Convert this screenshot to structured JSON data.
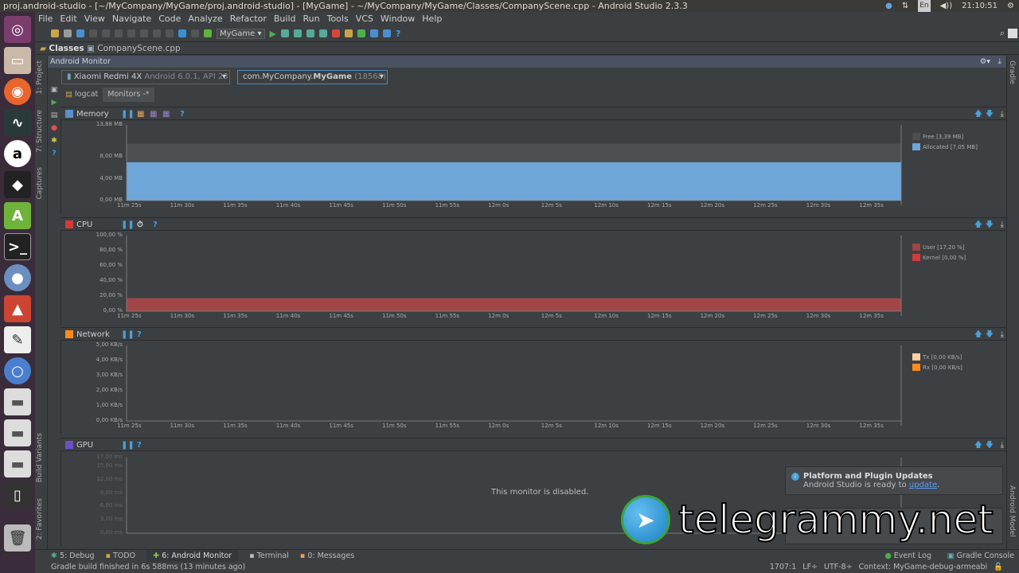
{
  "window_title": "proj.android-studio - [~/MyCompany/MyGame/proj.android-studio] - [MyGame] - ~/MyCompany/MyGame/Classes/CompanyScene.cpp - Android Studio 2.3.3",
  "tray": {
    "lang": "En",
    "time": "21:10:51"
  },
  "menu": [
    "File",
    "Edit",
    "View",
    "Navigate",
    "Code",
    "Analyze",
    "Refactor",
    "Build",
    "Run",
    "Tools",
    "VCS",
    "Window",
    "Help"
  ],
  "toolbar": {
    "run_config": "MyGame ▾",
    "help": "?"
  },
  "breadcrumb": [
    "Classes",
    "CompanyScene.cpp"
  ],
  "left_tool_tabs": [
    "1: Project",
    "7: Structure",
    "Captures",
    "Build Variants",
    "2: Favorites"
  ],
  "right_tool_tabs": [
    "Gradle",
    "Android Model"
  ],
  "monitor": {
    "title": "Android Monitor",
    "device": {
      "name": "Xiaomi Redmi 4X",
      "detail": "Android 6.0.1, API 23"
    },
    "process": {
      "prefix": "com.MyCompany.",
      "name": "MyGame",
      "pid": "(18568)"
    },
    "tabs": [
      "logcat",
      "Monitors"
    ]
  },
  "x_ticks": [
    "11m 25s",
    "11m 30s",
    "11m 35s",
    "11m 40s",
    "11m 45s",
    "11m 50s",
    "11m 55s",
    "12m 0s",
    "12m 5s",
    "12m 10s",
    "12m 15s",
    "12m 20s",
    "12m 25s",
    "12m 30s",
    "12m 35s"
  ],
  "chart_data": [
    {
      "type": "area",
      "title": "Memory",
      "y_ticks": [
        "13,88 MB",
        "8,00 MB",
        "4,00 MB",
        "0,00 MB"
      ],
      "ylim": [
        0,
        13.88
      ],
      "series": [
        {
          "name": "Allocated",
          "label": "Allocated [7,05 MB]",
          "value": 7.05,
          "color": "#6ea6d9"
        },
        {
          "name": "Free",
          "label": "Free [3,39 MB]",
          "value": 3.39,
          "color": "#4b4f51"
        }
      ]
    },
    {
      "type": "area",
      "title": "CPU",
      "y_ticks": [
        "100,00 %",
        "80,00 %",
        "60,00 %",
        "40,00 %",
        "20,00 %",
        "0,00 %"
      ],
      "ylim": [
        0,
        100
      ],
      "series": [
        {
          "name": "User",
          "label": "User [17,20 %]",
          "value": 17.2,
          "color": "#a04646"
        },
        {
          "name": "Kernel",
          "label": "Kernel [0,00 %]",
          "value": 0,
          "color": "#d33a3a"
        }
      ]
    },
    {
      "type": "area",
      "title": "Network",
      "y_ticks": [
        "5,00 KB/s",
        "4,00 KB/s",
        "3,00 KB/s",
        "2,00 KB/s",
        "1,00 KB/s",
        "0,00 KB/s"
      ],
      "ylim": [
        0,
        5
      ],
      "series": [
        {
          "name": "Tx",
          "label": "Tx [0,00 KB/s]",
          "value": 0,
          "color": "#ffd0a0"
        },
        {
          "name": "Rx",
          "label": "Rx [0,00 KB/s]",
          "value": 0,
          "color": "#ff8c1a"
        }
      ]
    },
    {
      "type": "area",
      "title": "GPU",
      "y_ticks": [
        "17,00 ms",
        "15,00 ms",
        "12,00 ms",
        "9,00 ms",
        "6,00 ms",
        "3,00 ms",
        "0,00 ms"
      ],
      "ylim": [
        0,
        17
      ],
      "series": [],
      "disabled_text": "This monitor is disabled."
    }
  ],
  "notifications": [
    {
      "title": "Platform and Plugin Updates",
      "body": "Android Studio is ready to ",
      "link": "update",
      "after": "."
    }
  ],
  "watermark": "telegrammy.net",
  "bottom_tabs": [
    "5: Debug",
    "TODO",
    "6: Android Monitor",
    "Terminal",
    "0: Messages"
  ],
  "bottom_right": [
    "Event Log",
    "Gradle Console"
  ],
  "status": {
    "message": "Gradle build finished in 6s 588ms (13 minutes ago)",
    "position": "1707:1",
    "line_sep": "LF÷",
    "encoding": "UTF-8÷",
    "context": "Context: MyGame-debug-armeabi"
  }
}
